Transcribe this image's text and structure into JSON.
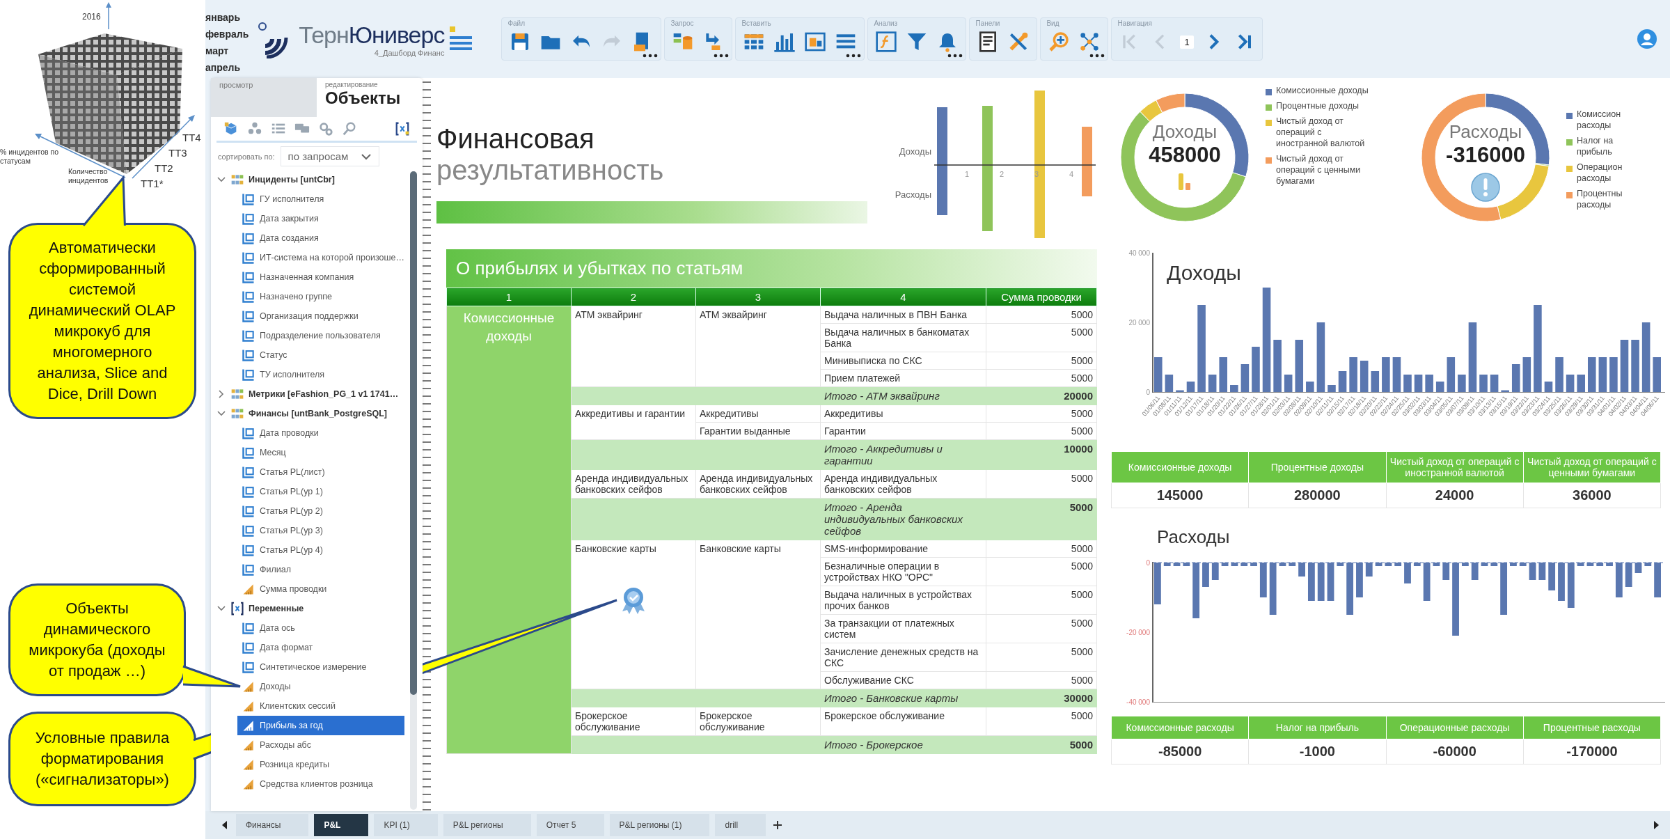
{
  "annotation": {
    "cube": {
      "year": "2016",
      "levels": [
        "ТТ4",
        "ТТ3",
        "ТТ2",
        "ТТ1*"
      ],
      "axis_left": "% инцидентов по статусам",
      "axis_front": "Количество инцидентов"
    },
    "callouts": [
      "Автоматически сформированный системой динамический OLAP микрокуб для многомерного анализа, Slice and Dice, Drill Down",
      "Объекты динамического микрокуба (доходы от продаж …)",
      "Условные правила форматирования («сигнализаторы»)"
    ]
  },
  "header": {
    "months": [
      "январь",
      "февраль",
      "март",
      "апрель"
    ],
    "logo_light": "Терн",
    "logo_bold": "Юниверс",
    "subtitle": "4_Дашборд Финанс"
  },
  "toolbar": [
    {
      "label": "Файл",
      "more": true
    },
    {
      "label": "Запрос",
      "more": true
    },
    {
      "label": "Вставить",
      "more": true
    },
    {
      "label": "Анализ",
      "more": true
    },
    {
      "label": "Панели",
      "more": false
    },
    {
      "label": "Вид",
      "more": true
    },
    {
      "label": "Навигация",
      "more": false,
      "page": "1"
    }
  ],
  "sidebar": {
    "tabs": [
      {
        "label": "просмотр",
        "selected": false
      },
      {
        "caption": "редактирование",
        "label": "Объекты",
        "selected": true
      }
    ],
    "sort_label": "сортировать по:",
    "sort_value": "по запросам",
    "tree": [
      {
        "label": "Инциденты [untCbr]",
        "kind": "folder",
        "expanded": true,
        "selected": false,
        "children": [
          {
            "label": "ГУ исполнителя",
            "kind": "dimension",
            "selected": false
          },
          {
            "label": "Дата закрытия",
            "kind": "dimension",
            "selected": false
          },
          {
            "label": "Дата создания",
            "kind": "dimension",
            "selected": false
          },
          {
            "label": "ИТ-система на которой произоше…",
            "kind": "dimension",
            "selected": false
          },
          {
            "label": "Назначенная компания",
            "kind": "dimension",
            "selected": false
          },
          {
            "label": "Назначено группе",
            "kind": "dimension",
            "selected": false
          },
          {
            "label": "Организация поддержки",
            "kind": "dimension",
            "selected": false
          },
          {
            "label": "Подразделение пользователя",
            "kind": "dimension",
            "selected": false
          },
          {
            "label": "Статус",
            "kind": "dimension",
            "selected": false
          },
          {
            "label": "ТУ исполнителя",
            "kind": "dimension",
            "selected": false
          }
        ]
      },
      {
        "label": "Метрики [eFashion_PG_1 v1 1741…",
        "kind": "folder",
        "expanded": false,
        "selected": false
      },
      {
        "label": "Финансы [untBank_PostgreSQL]",
        "kind": "folder",
        "expanded": true,
        "selected": false,
        "children": [
          {
            "label": "Дата проводки",
            "kind": "dimension",
            "selected": false
          },
          {
            "label": "Месяц",
            "kind": "dimension",
            "selected": false
          },
          {
            "label": "Статья PL(лист)",
            "kind": "dimension",
            "selected": false
          },
          {
            "label": "Статья PL(ур 1)",
            "kind": "dimension",
            "selected": false
          },
          {
            "label": "Статья PL(ур 2)",
            "kind": "dimension",
            "selected": false
          },
          {
            "label": "Статья PL(ур 3)",
            "kind": "dimension",
            "selected": false
          },
          {
            "label": "Статья PL(ур 4)",
            "kind": "dimension",
            "selected": false
          },
          {
            "label": "Филиал",
            "kind": "dimension",
            "selected": false
          },
          {
            "label": "Сумма проводки",
            "kind": "measure",
            "selected": false
          }
        ]
      },
      {
        "label": "Переменные",
        "kind": "variables",
        "expanded": true,
        "selected": false,
        "children": [
          {
            "label": "Дата ось",
            "kind": "dimension",
            "selected": false
          },
          {
            "label": "Дата формат",
            "kind": "dimension",
            "selected": false
          },
          {
            "label": "Синтетическое измерение",
            "kind": "dimension",
            "selected": false
          },
          {
            "label": "Доходы",
            "kind": "measure",
            "selected": false
          },
          {
            "label": "Клиентских сессий",
            "kind": "measure",
            "selected": false
          },
          {
            "label": "Прибыль за год",
            "kind": "measure",
            "selected": true
          },
          {
            "label": "Расходы абс",
            "kind": "measure",
            "selected": false
          },
          {
            "label": "Розница кредиты",
            "kind": "measure",
            "selected": false
          },
          {
            "label": "Средства клиентов розница",
            "kind": "measure",
            "selected": false
          }
        ]
      }
    ]
  },
  "report": {
    "title_1": "Финансовая",
    "title_2": "результативность",
    "mini_chart": {
      "labels": [
        "Доходы",
        "Расходы"
      ],
      "ticks": [
        "1",
        "2",
        "3",
        "4"
      ]
    },
    "table": {
      "title": "О прибылях и убытках по статьям",
      "columns": [
        "1",
        "2",
        "3",
        "4",
        "Сумма проводки"
      ],
      "category": "Комиссионные доходы",
      "groups": [
        {
          "name": "АТМ эквайринг",
          "badge": false,
          "subgroups": [
            {
              "name": "АТМ эквайринг",
              "rows": [
                {
                  "item": "Выдача наличных в ПВН Банка",
                  "sum": "5000"
                },
                {
                  "item": "Выдача наличных в банкоматах Банка",
                  "sum": "5000"
                },
                {
                  "item": "Минивыписка по СКС",
                  "sum": "5000"
                },
                {
                  "item": "Прием платежей",
                  "sum": "5000"
                }
              ]
            }
          ],
          "total_label": "Итого - АТМ эквайринг",
          "total": "20000"
        },
        {
          "name": "Аккредитивы и гарантии",
          "badge": false,
          "subgroups": [
            {
              "name": "Аккредитивы",
              "rows": [
                {
                  "item": "Аккредитивы",
                  "sum": "5000"
                }
              ]
            },
            {
              "name": "Гарантии выданные",
              "rows": [
                {
                  "item": "Гарантии",
                  "sum": "5000"
                }
              ]
            }
          ],
          "total_label": "Итого - Аккредитивы и гарантии",
          "total": "10000"
        },
        {
          "name": "Аренда индивидуальных банковских сейфов",
          "badge": false,
          "subgroups": [
            {
              "name": "Аренда индивидуальных банковских сейфов",
              "rows": [
                {
                  "item": "Аренда индивидуальных банковских сейфов",
                  "sum": "5000"
                }
              ]
            }
          ],
          "total_label": "Итого - Аренда индивидуальных банковских сейфов",
          "total": "5000"
        },
        {
          "name": "Банковские карты",
          "badge": true,
          "subgroups": [
            {
              "name": "Банковские карты",
              "rows": [
                {
                  "item": "SMS-информирование",
                  "sum": "5000"
                },
                {
                  "item": "Безналичные операции в устройствах НКО \"ОРС\"",
                  "sum": "5000"
                },
                {
                  "item": "Выдача наличных в устройствах прочих банков",
                  "sum": "5000"
                },
                {
                  "item": "За транзакции от платежных систем",
                  "sum": "5000"
                },
                {
                  "item": "Зачисление денежных средств на СКС",
                  "sum": "5000"
                },
                {
                  "item": "Обслуживание СКС",
                  "sum": "5000"
                }
              ]
            }
          ],
          "total_label": "Итого - Банковские карты",
          "total": "30000"
        },
        {
          "name": "Брокерское обслуживание",
          "badge": false,
          "subgroups": [
            {
              "name": "Брокерское обслуживание",
              "rows": [
                {
                  "item": "Брокерское обслуживание",
                  "sum": "5000"
                }
              ]
            }
          ],
          "total_label": "Итого - Брокерское",
          "total": "5000"
        }
      ]
    }
  },
  "donuts": [
    {
      "title": "Доходы",
      "total": "458000",
      "kind": "bars",
      "legend": [
        {
          "label": "Комиссионные доходы",
          "color": "#5a77b0"
        },
        {
          "label": "Процентные доходы",
          "color": "#8fc45a"
        },
        {
          "label": "Чистый доход от операций с иностранной валютой",
          "color": "#e8c63e"
        },
        {
          "label": "Чистый доход от операций с ценными бумагами",
          "color": "#f39c5d"
        }
      ],
      "chart_data": {
        "type": "donut",
        "values": [
          29.9,
          57.8,
          4.9,
          7.4
        ]
      }
    },
    {
      "title": "Расходы",
      "total": "-316000",
      "kind": "alert",
      "legend": [
        {
          "label": "Комиссион расходы",
          "color": "#5a77b0"
        },
        {
          "label": "Налог на прибыль",
          "color": "#8fc45a"
        },
        {
          "label": "Операцион расходы",
          "color": "#e8c63e"
        },
        {
          "label": "Процентны расходы",
          "color": "#f39c5d"
        }
      ],
      "chart_data": {
        "type": "donut",
        "values": [
          26.9,
          0.3,
          19.0,
          53.8
        ]
      }
    }
  ],
  "income_chart": {
    "title": "Доходы",
    "chart_data": {
      "type": "bar",
      "categories": [
        "01/06/11",
        "01/08/11",
        "01/11/11",
        "01/12/11",
        "01/17/11",
        "01/18/11",
        "01/20/11",
        "01/22/11",
        "01/26/11",
        "01/27/11",
        "01/28/11",
        "02/01/11",
        "02/03/11",
        "02/08/11",
        "02/09/11",
        "02/10/11",
        "02/11/11",
        "02/15/11",
        "02/17/11",
        "02/18/11",
        "02/20/11",
        "02/22/11",
        "02/24/11",
        "02/25/11",
        "03/02/11",
        "03/03/11",
        "03/04/11",
        "03/05/11",
        "03/07/11",
        "03/09/11",
        "03/10/11",
        "03/13/11",
        "03/15/11",
        "03/19/11",
        "03/22/11",
        "03/23/11",
        "03/24/11",
        "03/25/11",
        "03/26/11",
        "03/29/11",
        "03/30/11",
        "03/31/11",
        "04/01/11",
        "04/02/11",
        "04/03/11",
        "04/04/11",
        "04/06/11"
      ],
      "values": [
        10000,
        5000,
        500,
        3000,
        25000,
        5000,
        10000,
        2000,
        8000,
        13000,
        30000,
        15000,
        5000,
        15000,
        3000,
        20000,
        2000,
        6000,
        10000,
        9000,
        6000,
        10000,
        10000,
        5000,
        5000,
        5000,
        3000,
        10000,
        5000,
        20000,
        5000,
        5000,
        500,
        8000,
        10000,
        25000,
        3000,
        10000,
        5000,
        5000,
        10000,
        10000,
        10000,
        15000,
        15000,
        20000,
        10000
      ],
      "ylim": [
        0,
        40000
      ],
      "yticks": [
        {
          "value": 0,
          "label": "0"
        },
        {
          "value": 20000,
          "label": "20 000"
        },
        {
          "value": 40000,
          "label": "40 000"
        }
      ]
    }
  },
  "income_summary": {
    "columns": [
      "Комиссионные доходы",
      "Процентные доходы",
      "Чистый доход от операций с иностранной валютой",
      "Чистый доход от операций с ценными бумагами"
    ],
    "values": [
      "145000",
      "280000",
      "24000",
      "36000"
    ]
  },
  "expense_chart": {
    "title": "Расходы",
    "chart_data": {
      "type": "bar",
      "values": [
        -12000,
        -1000,
        -1000,
        -1000,
        -16000,
        -7000,
        -5000,
        -1000,
        -1000,
        -1000,
        -1000,
        -10000,
        -15000,
        -1000,
        -1000,
        -4000,
        -11000,
        -11000,
        -11000,
        -1000,
        -15000,
        -10000,
        -4000,
        -1000,
        -1000,
        -1000,
        -6000,
        -1000,
        -11000,
        -1000,
        -5000,
        -21000,
        -1000,
        -5000,
        -1000,
        -1000,
        -15000,
        -1000,
        -1000,
        -5000,
        -5000,
        -8000,
        -11000,
        -13000,
        -1000,
        -1000,
        -1000,
        -1000,
        -10000,
        -7000,
        -3000,
        -1000,
        -10000
      ],
      "ylim": [
        -40000,
        0
      ],
      "yticks": [
        {
          "value": 0,
          "label": "0"
        },
        {
          "value": -20000,
          "label": "-20 000"
        },
        {
          "value": -40000,
          "label": "-40 000"
        }
      ]
    }
  },
  "expense_summary": {
    "columns": [
      "Комиссионные расходы",
      "Налог на прибыль",
      "Операционные расходы",
      "Процентные расходы"
    ],
    "values": [
      "-85000",
      "-1000",
      "-60000",
      "-170000"
    ]
  },
  "sheet_tabs": [
    {
      "label": "Финансы",
      "selected": false
    },
    {
      "label": "P&L",
      "selected": true
    },
    {
      "label": "KPI (1)",
      "selected": false
    },
    {
      "label": "P&L регионы",
      "selected": false
    },
    {
      "label": "Отчет 5",
      "selected": false
    },
    {
      "label": "P&L регионы (1)",
      "selected": false
    },
    {
      "label": "drill",
      "selected": false
    }
  ]
}
